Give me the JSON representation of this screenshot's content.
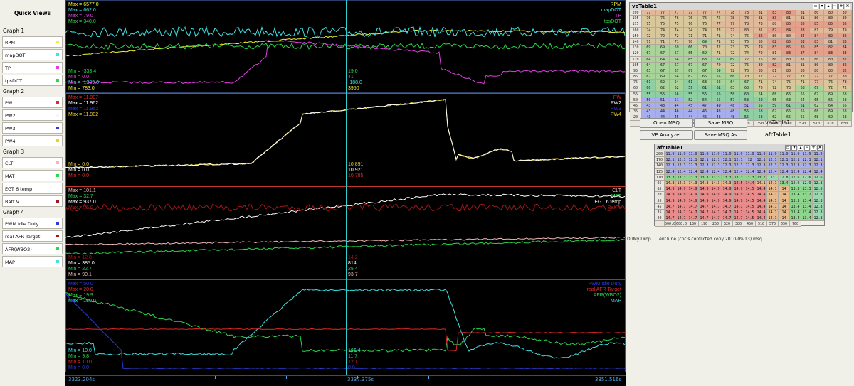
{
  "sidebar": {
    "title": "Quick Views",
    "groups": [
      {
        "title": "Graph 1",
        "items": [
          {
            "label": "RPM",
            "color": "#f2f233"
          },
          {
            "label": "mapDOT",
            "color": "#3de3e3"
          },
          {
            "label": "TP",
            "color": "#e23fe2"
          },
          {
            "label": "tpsDOT",
            "color": "#2ad84a"
          }
        ]
      },
      {
        "title": "Graph 2",
        "items": [
          {
            "label": "PW",
            "color": "#e02828"
          },
          {
            "label": "PW2",
            "color": "#f5f5f5"
          },
          {
            "label": "PW3",
            "color": "#2c3bd8"
          },
          {
            "label": "PW4",
            "color": "#e8d22a"
          }
        ]
      },
      {
        "title": "Graph 3",
        "items": [
          {
            "label": "CLT",
            "color": "#f2b6b6"
          },
          {
            "label": "MAT",
            "color": "#2ad84a"
          },
          {
            "label": "EGT 6 temp",
            "color": "#ffffff"
          },
          {
            "label": "Batt V",
            "color": "#a01818"
          }
        ]
      },
      {
        "title": "Graph 4",
        "items": [
          {
            "label": "PWM Idle Duty",
            "color": "#2c3bd8"
          },
          {
            "label": "real AFR Target",
            "color": "#a01818"
          },
          {
            "label": "AFR(WBO2)",
            "color": "#2ad84a"
          },
          {
            "label": "MAP",
            "color": "#3de3e3"
          }
        ]
      }
    ]
  },
  "plots": [
    {
      "names": [
        [
          "RPM",
          "#f2f233"
        ],
        [
          "mapDOT",
          "#3de3e3"
        ],
        [
          "TP",
          "#e23fe2"
        ],
        [
          "tpsDOT",
          "#2ad84a"
        ]
      ],
      "max": [
        [
          "Max = 6577.0",
          "#f2f233"
        ],
        [
          "Max = 662.0",
          "#3de3e3"
        ],
        [
          "Max = 79.0",
          "#e23fe2"
        ],
        [
          "Max = 340.0",
          "#2ad84a"
        ]
      ],
      "min": [
        [
          "Min = -333.4",
          "#2ad84a"
        ],
        [
          "Min = 0.0",
          "#e23fe2"
        ],
        [
          "Min = -1309.0",
          "#3de3e3"
        ],
        [
          "Min = 783.0",
          "#f2f233"
        ]
      ],
      "cursor": [
        [
          "19.0",
          "#2ad84a"
        ],
        [
          "41",
          "#e23fe2"
        ],
        [
          "-188.0",
          "#3de3e3"
        ],
        [
          "3950",
          "#f2f233"
        ]
      ]
    },
    {
      "names": [
        [
          "PW",
          "#e02828"
        ],
        [
          "PW2",
          "#ffffff"
        ],
        [
          "PW3",
          "#2c3bd8"
        ],
        [
          "PW4",
          "#e8d22a"
        ]
      ],
      "max": [
        [
          "Max = 11.907",
          "#e02828"
        ],
        [
          "Max = 11.962",
          "#ffffff"
        ],
        [
          "Max = 11.962",
          "#2c3bd8"
        ],
        [
          "Max = 11.902",
          "#e8d22a"
        ]
      ],
      "min": [
        [
          "Min = 0.0",
          "#e8d22a"
        ],
        [
          "Min = 0.0",
          "#ffffff"
        ],
        [
          "Min = 0.0",
          "#e02828"
        ]
      ],
      "cursor": [
        [
          "10.891",
          "#e8d22a"
        ],
        [
          "10.921",
          "#ffffff"
        ],
        [
          "10.785",
          "#e02828"
        ]
      ]
    },
    {
      "names": [
        [
          "CLT",
          "#f2b6b6"
        ],
        [
          "MAT",
          "#2ad84a"
        ],
        [
          "EGT 6 temp",
          "#ffffff"
        ],
        [
          "Batt V",
          "#a01818"
        ]
      ],
      "max": [
        [
          "Max = 101.1",
          "#f2b6b6"
        ],
        [
          "Max = 32.7",
          "#2ad84a"
        ],
        [
          "Max = 937.0",
          "#ffffff"
        ],
        [
          "Max = 15.0",
          "#a01818"
        ]
      ],
      "min": [
        [
          "Min = 12.8",
          "#a01818"
        ],
        [
          "Min = 385.0",
          "#ffffff"
        ],
        [
          "Min = 22.7",
          "#2ad84a"
        ],
        [
          "Min = 90.1",
          "#f2b6b6"
        ]
      ],
      "cursor": [
        [
          "14.2",
          "#a01818"
        ],
        [
          "814",
          "#ffffff"
        ],
        [
          "25.4",
          "#2ad84a"
        ],
        [
          "93.7",
          "#f2b6b6"
        ]
      ]
    },
    {
      "names": [
        [
          "PWM Idle Duty",
          "#2c3bd8"
        ],
        [
          "real AFR Target",
          "#e02828"
        ],
        [
          "AFR(WBO2)",
          "#2ad84a"
        ],
        [
          "MAP",
          "#3de3e3"
        ]
      ],
      "max": [
        [
          "Max = 50.0",
          "#2c3bd8"
        ],
        [
          "Max = 20.0",
          "#e02828"
        ],
        [
          "Max = 19.9",
          "#2ad84a"
        ],
        [
          "Max = 180.0",
          "#3de3e3"
        ]
      ],
      "min": [
        [
          "Min = 10.0",
          "#3de3e3"
        ],
        [
          "Min = 9.8",
          "#2ad84a"
        ],
        [
          "Min = 10.0",
          "#e02828"
        ],
        [
          "Min = 0.0",
          "#2c3bd8"
        ]
      ],
      "cursor": [
        [
          "166.4",
          "#3de3e3"
        ],
        [
          "11.7",
          "#2ad84a"
        ],
        [
          "12.1",
          "#e02828"
        ],
        [
          "0.0",
          "#2c3bd8"
        ]
      ]
    }
  ],
  "time": {
    "start": "3323.204s",
    "cursor": "3337.375s",
    "end": "3351.516s"
  },
  "ve_table": {
    "title": "veTable1",
    "rows": [
      "200",
      "195",
      "175",
      "160",
      "150",
      "140",
      "130",
      "120",
      "110",
      "105",
      "95",
      "85",
      "75",
      "60",
      "55",
      "50",
      "45",
      "35",
      "20"
    ],
    "cols": [
      "500.0",
      "100",
      "150",
      "190",
      "240",
      "280",
      "320",
      "370",
      "390",
      "440",
      "460",
      "520",
      "570",
      "610",
      "650",
      "720"
    ],
    "cells": [
      [
        77,
        77,
        77,
        77,
        77,
        77,
        78,
        78,
        81,
        83,
        83,
        81,
        80,
        80,
        80
      ],
      [
        76,
        76,
        76,
        76,
        76,
        76,
        78,
        78,
        81,
        83,
        81,
        81,
        80,
        80,
        80
      ],
      [
        75,
        75,
        75,
        76,
        76,
        77,
        77,
        78,
        78,
        80,
        86,
        85,
        85,
        85,
        85
      ],
      [
        74,
        74,
        74,
        74,
        74,
        73,
        77,
        80,
        81,
        82,
        84,
        83,
        81,
        79,
        79
      ],
      [
        72,
        72,
        72,
        71,
        71,
        71,
        74,
        76,
        82,
        80,
        80,
        84,
        84,
        82,
        82
      ],
      [
        71,
        71,
        71,
        70,
        69,
        71,
        73,
        76,
        80,
        82,
        85,
        83,
        83,
        81,
        83
      ],
      [
        69,
        69,
        69,
        66,
        70,
        72,
        73,
        76,
        79,
        83,
        85,
        86,
        85,
        82,
        84
      ],
      [
        67,
        67,
        67,
        65,
        69,
        71,
        72,
        74,
        79,
        81,
        83,
        87,
        84,
        83,
        83
      ],
      [
        64,
        64,
        64,
        65,
        68,
        67,
        69,
        72,
        76,
        80,
        80,
        81,
        80,
        80,
        82
      ],
      [
        64,
        67,
        67,
        67,
        67,
        70,
        72,
        76,
        80,
        82,
        81,
        81,
        80,
        80,
        82
      ],
      [
        63,
        67,
        67,
        67,
        67,
        69,
        72,
        76,
        80,
        81,
        80,
        80,
        80,
        80,
        82
      ],
      [
        62,
        69,
        64,
        62,
        65,
        65,
        66,
        70,
        72,
        77,
        77,
        73,
        77,
        77,
        80
      ],
      [
        61,
        62,
        64,
        61,
        63,
        62,
        64,
        67,
        71,
        74,
        75,
        71,
        77,
        76,
        78
      ],
      [
        60,
        62,
        62,
        59,
        61,
        61,
        63,
        68,
        70,
        72,
        73,
        68,
        69,
        72,
        72
      ],
      [
        55,
        56,
        56,
        55,
        56,
        56,
        58,
        60,
        64,
        68,
        66,
        66,
        67,
        69,
        68
      ],
      [
        50,
        51,
        51,
        52,
        54,
        55,
        57,
        58,
        60,
        65,
        63,
        64,
        65,
        66,
        68
      ],
      [
        43,
        43,
        44,
        45,
        47,
        49,
        48,
        51,
        55,
        59,
        61,
        61,
        62,
        64,
        66
      ],
      [
        43,
        44,
        46,
        44,
        46,
        48,
        48,
        55,
        58,
        62,
        65,
        65,
        68,
        69,
        68
      ],
      [
        43,
        44,
        45,
        44,
        46,
        48,
        48,
        55,
        58,
        62,
        65,
        65,
        68,
        69,
        68
      ]
    ]
  },
  "buttons": {
    "open_msq": "Open MSQ",
    "save_msq": "Save MSQ",
    "ve_analyzer": "VE Analyzer",
    "save_msq_as": "Save MSQ As"
  },
  "tabs": {
    "ve": "veTable1",
    "afr": "afrTable1"
  },
  "afr_table": {
    "title": "afrTable1",
    "rows": [
      "200",
      "170",
      "140",
      "125",
      "110",
      "95",
      "85",
      "70",
      "55",
      "45",
      "35",
      "20"
    ],
    "cols": [
      "500.0",
      "600.0",
      "130",
      "190",
      "250",
      "320",
      "380",
      "450",
      "510",
      "570",
      "650",
      "760"
    ],
    "cells": [
      [
        11.9,
        11.9,
        11.9,
        11.9,
        11.9,
        11.9,
        11.9,
        11.9,
        11.9,
        11.9,
        11.9,
        11.9,
        11.9,
        11.9
      ],
      [
        12.1,
        12.1,
        12.1,
        12.1,
        12.1,
        12.1,
        12.1,
        12.0,
        12.1,
        12.1,
        12.1,
        12.1,
        12.1,
        12.1
      ],
      [
        12.3,
        12.3,
        12.3,
        12.3,
        12.3,
        12.3,
        12.3,
        12.3,
        12.3,
        12.3,
        12.3,
        12.3,
        12.3,
        12.3
      ],
      [
        12.4,
        12.4,
        12.4,
        12.4,
        12.4,
        12.4,
        12.4,
        12.4,
        12.4,
        12.4,
        12.4,
        12.4,
        12.4,
        12.4
      ],
      [
        13.3,
        13.3,
        13.3,
        13.3,
        13.3,
        13.3,
        13.3,
        13.3,
        13.2,
        13.0,
        12.8,
        12.6,
        12.6,
        12.6
      ],
      [
        14.3,
        14.3,
        14.3,
        14.3,
        14.3,
        14.3,
        14.5,
        14.4,
        14.1,
        14.1,
        13.4,
        12.9,
        12.9,
        12.8
      ],
      [
        14.9,
        14.9,
        14.9,
        14.9,
        14.9,
        14.9,
        14.9,
        14.5,
        14.4,
        14.1,
        14.0,
        13.3,
        13.3,
        12.8
      ],
      [
        14.9,
        14.9,
        14.9,
        14.9,
        14.9,
        14.9,
        14.9,
        14.5,
        14.4,
        14.1,
        14.0,
        13.4,
        13.2,
        12.8
      ],
      [
        14.9,
        14.9,
        14.9,
        14.9,
        14.9,
        14.9,
        14.9,
        14.5,
        14.4,
        14.1,
        14.0,
        13.3,
        13.4,
        12.8
      ],
      [
        14.7,
        14.7,
        14.7,
        14.7,
        14.7,
        14.7,
        14.7,
        14.5,
        14.4,
        14.1,
        14.0,
        13.4,
        13.4,
        12.8
      ],
      [
        14.7,
        14.7,
        14.7,
        14.7,
        14.7,
        14.7,
        14.7,
        14.5,
        14.4,
        14.1,
        14.0,
        13.4,
        13.4,
        12.8
      ],
      [
        14.7,
        14.7,
        14.7,
        14.7,
        14.7,
        14.7,
        14.7,
        14.5,
        14.4,
        14.1,
        14.0,
        13.4,
        13.4,
        12.8
      ]
    ]
  },
  "file_path": "D:\\My Drop .... entTune (cpc's conflicted copy 2010-09-13).msq"
}
